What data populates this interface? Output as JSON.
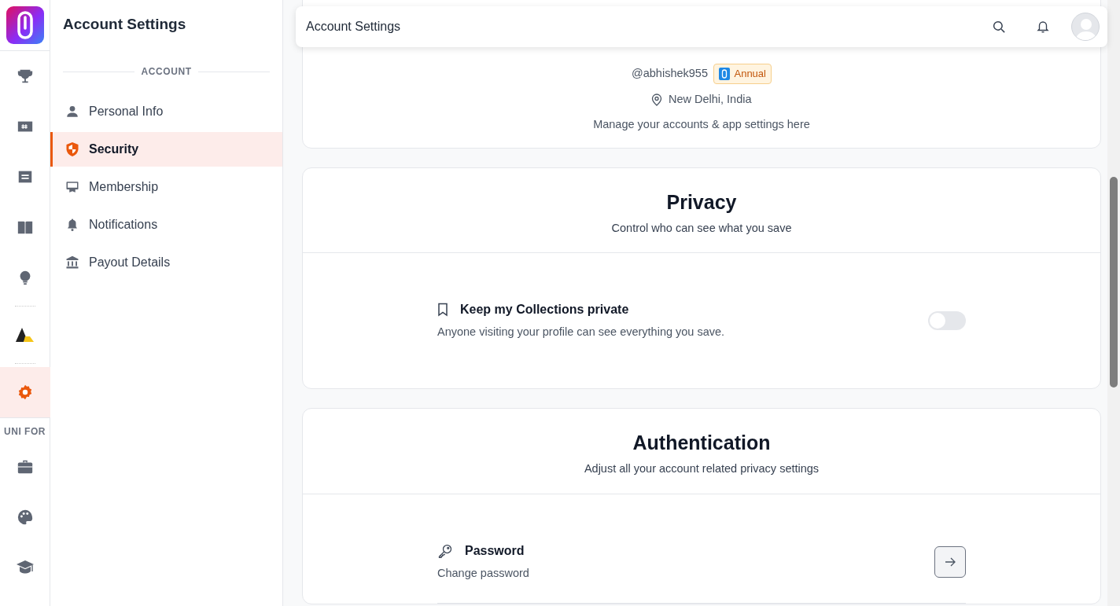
{
  "rail": {
    "items": [
      {
        "kind": "trophy",
        "selected": false
      },
      {
        "kind": "ticket",
        "selected": false
      },
      {
        "kind": "message",
        "selected": false
      },
      {
        "kind": "book",
        "selected": false
      },
      {
        "kind": "bulb",
        "selected": false
      },
      {
        "kind": "brand",
        "selected": false
      },
      {
        "kind": "gear",
        "selected": true
      }
    ],
    "section_label": "UNI FOR",
    "section_items": [
      {
        "kind": "briefcase",
        "selected": false
      },
      {
        "kind": "palette",
        "selected": false
      },
      {
        "kind": "cap",
        "selected": false
      }
    ]
  },
  "sidebar": {
    "title": "Account Settings",
    "section": "ACCOUNT",
    "items": [
      {
        "kind": "person",
        "label": "Personal Info",
        "selected": false
      },
      {
        "kind": "shield",
        "label": "Security",
        "selected": true
      },
      {
        "kind": "monitor",
        "label": "Membership",
        "selected": false
      },
      {
        "kind": "bell",
        "label": "Notifications",
        "selected": false
      },
      {
        "kind": "bank",
        "label": "Payout Details",
        "selected": false
      }
    ]
  },
  "header": {
    "title": "Account Settings"
  },
  "profile": {
    "handle": "@abhishek955",
    "badge": "Annual",
    "location": "New Delhi, India",
    "note": "Manage your accounts & app settings here"
  },
  "sections": [
    {
      "title": "Privacy",
      "subtitle": "Control who can see what you save",
      "rows": [
        {
          "kind": "toggle",
          "title": "Keep my Collections private",
          "description": "Anyone visiting your profile can see everything you save.",
          "on": false
        }
      ]
    },
    {
      "title": "Authentication",
      "subtitle": "Adjust all your account related privacy settings",
      "rows": [
        {
          "kind": "link",
          "title": "Password",
          "description": "Change password"
        }
      ]
    }
  ]
}
